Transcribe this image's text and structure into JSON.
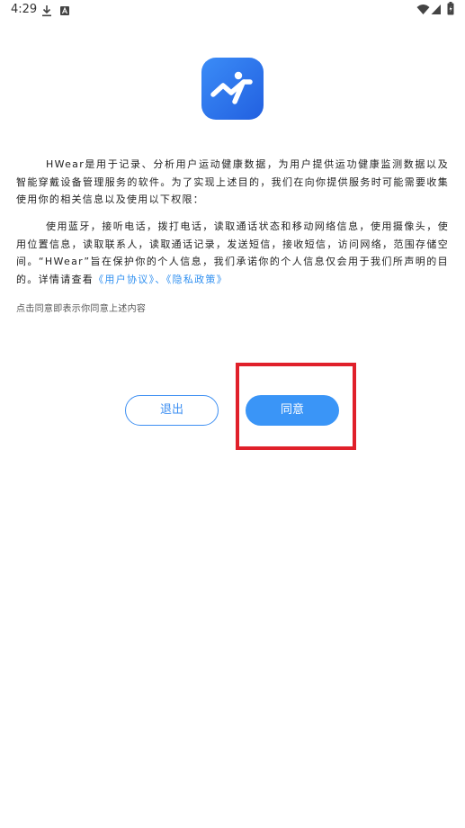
{
  "status_bar": {
    "time": "4:29",
    "icons": [
      "download-icon",
      "a-notification-icon",
      "wifi-icon",
      "signal-icon",
      "battery-icon"
    ]
  },
  "app": {
    "logo_icon": "hwear-logo-icon",
    "brand_color": "#2f7cf0"
  },
  "intro": {
    "paragraph_1": "HWear是用于记录、分析用户运动健康数据，为用户提供运功健康监测数据以及智能穿戴设备管理服务的软件。为了实现上述目的，我们在向你提供服务时可能需要收集使用你的相关信息以及使用以下权限：",
    "paragraph_2_text": "使用蓝牙，接听电话，拨打电话，读取通话状态和移动网络信息，使用摄像头，使用位置信息，读取联系人，读取通话记录，发送短信，接收短信，访问网络，范围存储空间。“HWear”旨在保护你的个人信息，我们承诺你的个人信息仅会用于我们所声明的目的。详情请查看",
    "user_agreement_link": "《用户协议》",
    "separator": "、",
    "privacy_policy_link": "《隐私政策》",
    "consent_note": "点击同意即表示你同意上述内容"
  },
  "buttons": {
    "exit_label": "退出",
    "agree_label": "同意"
  },
  "colors": {
    "link": "#2f8ff0",
    "primary": "#3a95f7",
    "highlight": "#e0202a"
  }
}
